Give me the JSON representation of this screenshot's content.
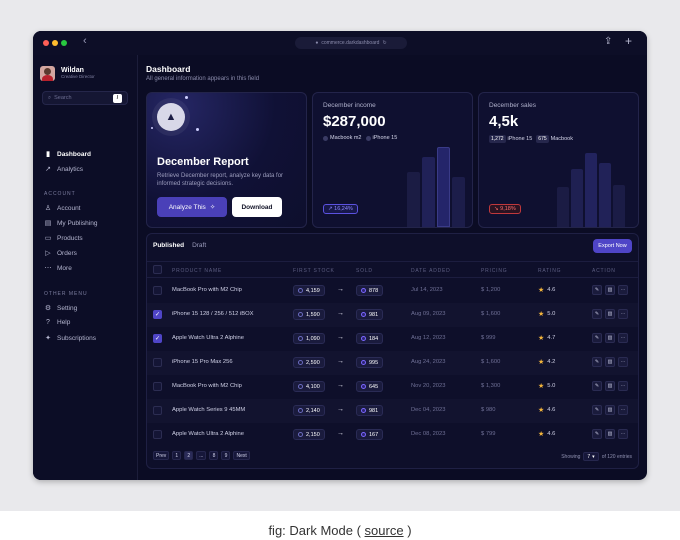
{
  "browser": {
    "url": "commerce.darkdashboard",
    "back_icon": "chevron-left-icon",
    "share_icon": "share-icon",
    "new_tab_icon": "plus-icon"
  },
  "profile": {
    "name": "Wildan",
    "role": "Creative Director"
  },
  "search": {
    "placeholder": "Search",
    "shortcut": "/"
  },
  "sidebar": {
    "main_items": [
      {
        "label": "Dashboard",
        "icon": "bar-chart-icon"
      },
      {
        "label": "Analytics",
        "icon": "trend-icon"
      }
    ],
    "account_title": "ACCOUNT",
    "account_items": [
      {
        "label": "Account",
        "icon": "user-icon"
      },
      {
        "label": "My Publishing",
        "icon": "book-icon"
      },
      {
        "label": "Products",
        "icon": "folder-icon"
      },
      {
        "label": "Orders",
        "icon": "send-icon"
      },
      {
        "label": "More",
        "icon": "more-icon"
      }
    ],
    "other_title": "OTHER MENU",
    "other_items": [
      {
        "label": "Setting",
        "icon": "gear-icon"
      },
      {
        "label": "Help",
        "icon": "help-icon"
      },
      {
        "label": "Subscriptions",
        "icon": "sparkle-icon"
      }
    ]
  },
  "header": {
    "title": "Dashboard",
    "subtitle": "All general information appears in this field"
  },
  "report": {
    "title": "December Report",
    "description": "Retrieve December report, analyze key data for informed strategic decisions.",
    "analyze_label": "Analyze This",
    "download_label": "Download"
  },
  "income": {
    "title": "December income",
    "value": "$287,000",
    "tags": [
      "Macbook m2",
      "iPhone 15"
    ],
    "change": "16,24%"
  },
  "sales": {
    "title": "December sales",
    "value": "4,5k",
    "tags": [
      {
        "count": "1,272",
        "label": "iPhone 15"
      },
      {
        "count": "675",
        "label": "Macbook"
      }
    ],
    "change": "9,18%"
  },
  "colors": {
    "accent": "#4f45c7",
    "up": "#8f88ff",
    "down": "#ff6d6d",
    "star": "#f2b43b"
  },
  "table": {
    "tab_published": "Published",
    "tab_draft": "Draft",
    "export_label": "Export Now",
    "headers": [
      "PRODUCT NAME",
      "FIRST STOCK",
      "SOLD",
      "DATE ADDED",
      "PRICING",
      "RATING",
      "ACTION"
    ],
    "rows": [
      {
        "name": "MacBook Pro with M2 Chip",
        "stock": "4,159",
        "sold": "878",
        "date": "Jul 14, 2023",
        "price": "$ 1,200",
        "rating": "4.6",
        "checked": false
      },
      {
        "name": "iPhone 15 128 / 256 / 512 iBOX",
        "stock": "1,590",
        "sold": "981",
        "date": "Aug 09, 2023",
        "price": "$ 1,600",
        "rating": "5.0",
        "checked": true
      },
      {
        "name": "Apple Watch Ultra 2 Alphine",
        "stock": "1,090",
        "sold": "184",
        "date": "Aug 12, 2023",
        "price": "$ 999",
        "rating": "4.7",
        "checked": true
      },
      {
        "name": "iPhone 15 Pro Max 256",
        "stock": "2,590",
        "sold": "995",
        "date": "Aug 24, 2023",
        "price": "$ 1,600",
        "rating": "4.2",
        "checked": false
      },
      {
        "name": "MacBook Pro with M2 Chip",
        "stock": "4,100",
        "sold": "645",
        "date": "Nov 20, 2023",
        "price": "$ 1,300",
        "rating": "5.0",
        "checked": false
      },
      {
        "name": "Apple Watch Series 9 45MM",
        "stock": "2,140",
        "sold": "981",
        "date": "Dec 04, 2023",
        "price": "$ 980",
        "rating": "4.6",
        "checked": false
      },
      {
        "name": "Apple Watch Ultra 2 Alphine",
        "stock": "2,150",
        "sold": "167",
        "date": "Dec 08, 2023",
        "price": "$ 799",
        "rating": "4.6",
        "checked": false
      }
    ],
    "pagination": {
      "prev": "Prev",
      "pages": [
        "1",
        "2",
        "...",
        "8",
        "9"
      ],
      "next": "Next"
    },
    "showing_label": "Showing",
    "per_page": "7",
    "total_label": "of 120 entries"
  },
  "caption": {
    "prefix": "fig: Dark Mode (",
    "link": "source",
    "suffix": ")"
  }
}
